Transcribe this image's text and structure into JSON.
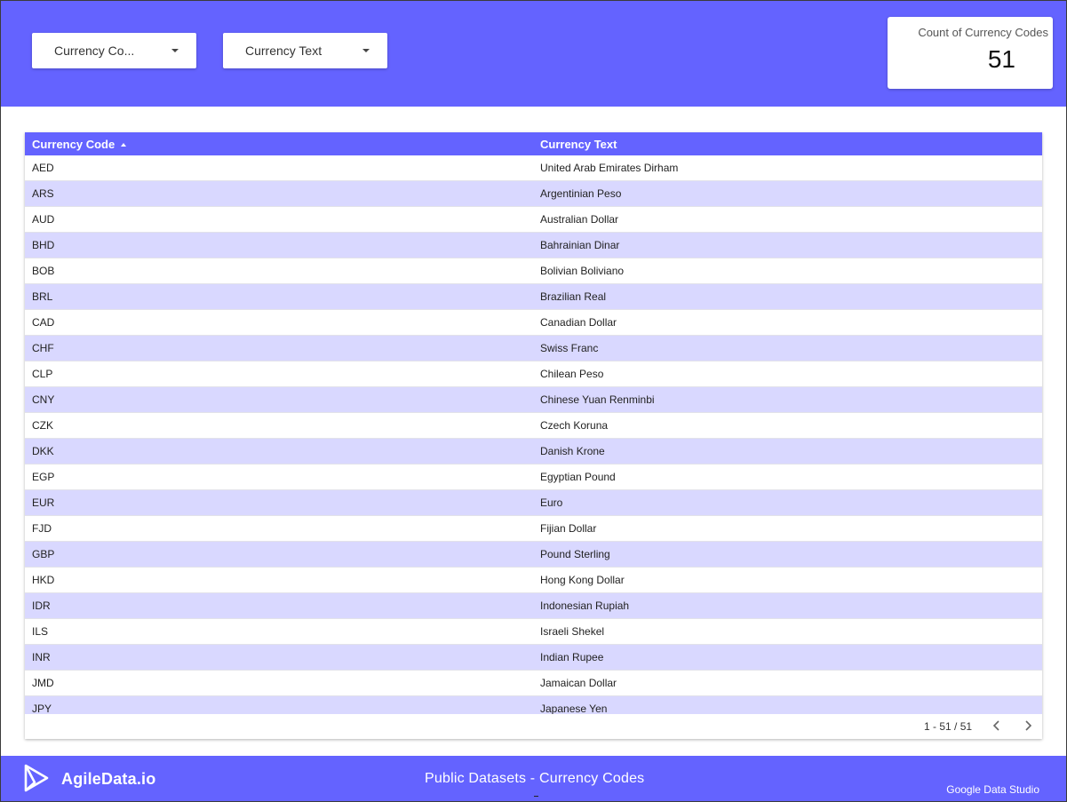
{
  "header": {
    "filters": [
      {
        "label": "Currency Co..."
      },
      {
        "label": "Currency Text"
      }
    ],
    "scorecard": {
      "label": "Count of Currency Codes",
      "value": "51"
    }
  },
  "table": {
    "columns": [
      "Currency Code",
      "Currency Text"
    ],
    "sort_icon": "sort-ascending-icon",
    "rows": [
      [
        "AED",
        "United Arab Emirates Dirham"
      ],
      [
        "ARS",
        "Argentinian Peso"
      ],
      [
        "AUD",
        "Australian Dollar"
      ],
      [
        "BHD",
        "Bahrainian Dinar"
      ],
      [
        "BOB",
        "Bolivian Boliviano"
      ],
      [
        "BRL",
        "Brazilian Real"
      ],
      [
        "CAD",
        "Canadian Dollar"
      ],
      [
        "CHF",
        "Swiss Franc"
      ],
      [
        "CLP",
        "Chilean Peso"
      ],
      [
        "CNY",
        "Chinese Yuan Renminbi"
      ],
      [
        "CZK",
        "Czech Koruna"
      ],
      [
        "DKK",
        "Danish Krone"
      ],
      [
        "EGP",
        "Egyptian Pound"
      ],
      [
        "EUR",
        "Euro"
      ],
      [
        "FJD",
        "Fijian Dollar"
      ],
      [
        "GBP",
        "Pound Sterling"
      ],
      [
        "HKD",
        "Hong Kong Dollar"
      ],
      [
        "IDR",
        "Indonesian Rupiah"
      ],
      [
        "ILS",
        "Israeli Shekel"
      ],
      [
        "INR",
        "Indian Rupee"
      ],
      [
        "JMD",
        "Jamaican Dollar"
      ],
      [
        "JPY",
        "Japanese Yen"
      ]
    ],
    "pager": {
      "range": "1 - 51 / 51",
      "prev_icon": "chevron-left-icon",
      "next_icon": "chevron-right-icon"
    }
  },
  "footer": {
    "brand": "AgileData.io",
    "title": "Public Datasets - Currency Codes",
    "credit": "Google Data Studio"
  },
  "colors": {
    "accent": "#6463ff",
    "row_stripe": "#d9d8ff",
    "white": "#ffffff"
  }
}
